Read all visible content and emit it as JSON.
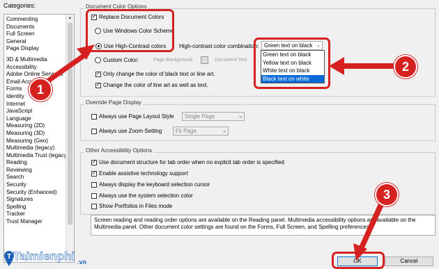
{
  "categories_label": "Categories:",
  "categories_top": [
    "Commenting",
    "Documents",
    "Full Screen",
    "General",
    "Page Display"
  ],
  "categories_bottom": [
    "3D & Multimedia",
    "Accessibility",
    "Adobe Online Services",
    "Email Accounts",
    "Forms",
    "Identity",
    "Internet",
    "JavaScript",
    "Language",
    "Measuring (2D)",
    "Measuring (3D)",
    "Measuring (Geo)",
    "Multimedia (legacy)",
    "Multimedia Trust (legacy)",
    "Reading",
    "Reviewing",
    "Search",
    "Security",
    "Security (Enhanced)",
    "Signatures",
    "Spelling",
    "Tracker",
    "Trust Manager"
  ],
  "doc_colors": {
    "title": "Document Color Options",
    "replace_label": "Replace Document Colors",
    "windows_scheme_label": "Use Windows Color Scheme",
    "high_contrast_label": "Use High-Contrast colors",
    "custom_label": "Custom Color:",
    "page_bg_label": "Page Background:",
    "doc_text_label": "Document Text",
    "hc_combo_label": "High-contrast color combination:",
    "hc_selected": "Green text on black",
    "hc_options": [
      "Green text on black",
      "Yellow text on black",
      "White text on black",
      "Black text on white"
    ],
    "only_black_label": "Only change the color of black text or line art.",
    "line_art_label": "Change the color of line art as well as text."
  },
  "override": {
    "title": "Override Page Display",
    "page_layout_label": "Always use Page Layout Style",
    "page_layout_value": "Single Page",
    "zoom_label": "Always use Zoom Setting",
    "zoom_value": "Fit Page"
  },
  "other": {
    "title": "Other Accessibility Options",
    "items": [
      {
        "label": "Use document structure for tab order when no explicit tab order is specified",
        "checked": true
      },
      {
        "label": "Enable assistive technology support",
        "checked": true
      },
      {
        "label": "Always display the keyboard selection cursor",
        "checked": false
      },
      {
        "label": "Always use the system selection color",
        "checked": false
      },
      {
        "label": "Show Portfolios in Files mode",
        "checked": false
      }
    ]
  },
  "info_text": "Screen reading and reading order options are available on the Reading panel. Multimedia accessibility options are available on the Multimedia panel. Other document color settings are found on the Forms, Full Screen, and Spelling preferences.",
  "ok_label": "OK",
  "cancel_label": "Cancel",
  "badges": [
    "1",
    "2",
    "3"
  ],
  "watermark": {
    "brand": "Taimienphi",
    "tld": ".vn"
  },
  "colors": {
    "annotation_red": "#d62121",
    "highlight_blue": "#0a6ad8"
  }
}
